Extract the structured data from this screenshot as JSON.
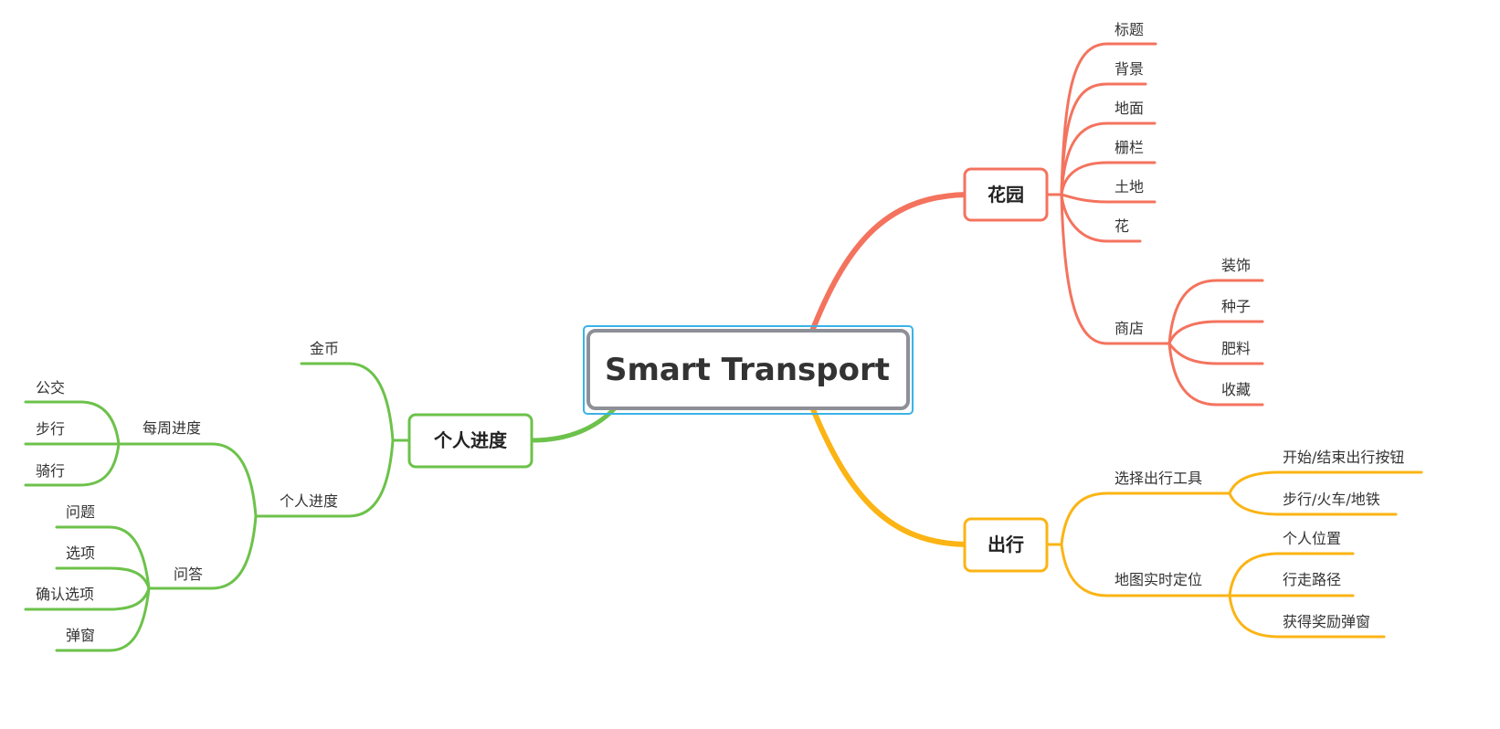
{
  "colors": {
    "garden": "#f4735e",
    "travel": "#fbb414",
    "progress": "#6cc24a",
    "root_border": "#8e9098",
    "root_selection": "#3ab3e6",
    "text": "#333333"
  },
  "root": {
    "label": "Smart Transport"
  },
  "garden": {
    "label": "花园",
    "items": [
      "标题",
      "背景",
      "地面",
      "栅栏",
      "土地",
      "花"
    ],
    "shop": {
      "label": "商店",
      "items": [
        "装饰",
        "种子",
        "肥料",
        "收藏"
      ]
    }
  },
  "travel": {
    "label": "出行",
    "tool": {
      "label": "选择出行工具",
      "items": [
        "开始/结束出行按钮",
        "步行/火车/地铁"
      ]
    },
    "map": {
      "label": "地图实时定位",
      "items": [
        "个人位置",
        "行走路径",
        "获得奖励弹窗"
      ]
    }
  },
  "progress": {
    "label": "个人进度",
    "coins": "金币",
    "sub": {
      "label": "个人进度",
      "weekly": {
        "label": "每周进度",
        "items": [
          "公交",
          "步行",
          "骑行"
        ]
      },
      "qa": {
        "label": "问答",
        "items": [
          "问题",
          "选项",
          "确认选项",
          "弹窗"
        ]
      }
    }
  }
}
